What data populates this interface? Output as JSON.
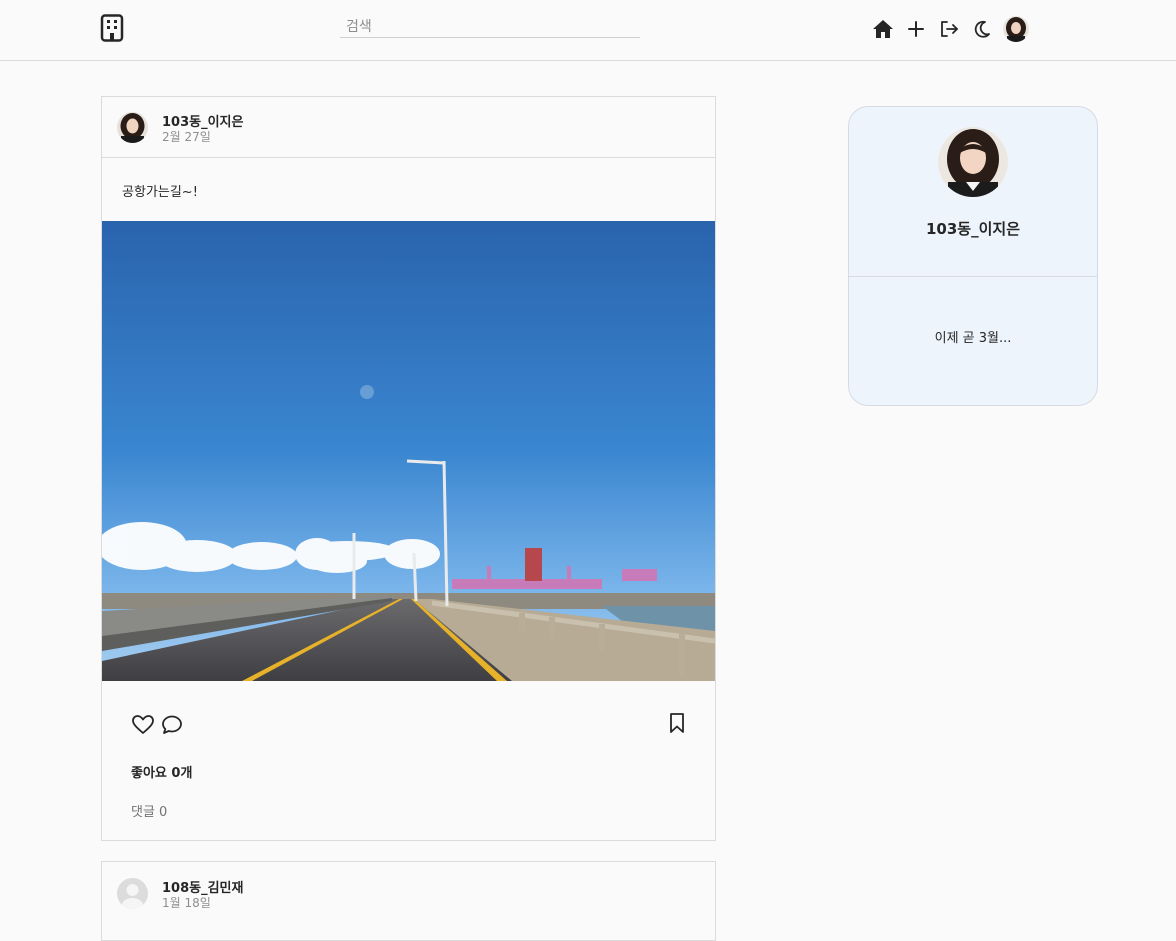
{
  "header": {
    "search_placeholder": "검색",
    "icons": [
      "building-icon",
      "home-icon",
      "plus-icon",
      "logout-icon",
      "moon-icon",
      "avatar"
    ]
  },
  "post": {
    "username": "103동_이지은",
    "date": "2월 27일",
    "caption": "공항가는길~!",
    "likes": "좋아요 0개",
    "comments": "댓글 0"
  },
  "post2": {
    "username": "108동_김민재",
    "date": "1월 18일"
  },
  "profile": {
    "username": "103동_이지은",
    "bio": "이제 곧 3월..."
  },
  "colors": {
    "background": "#fafafa",
    "border": "#dbdbdb",
    "profile_card": "#eef4fc",
    "sky": "#2b6bb5"
  }
}
